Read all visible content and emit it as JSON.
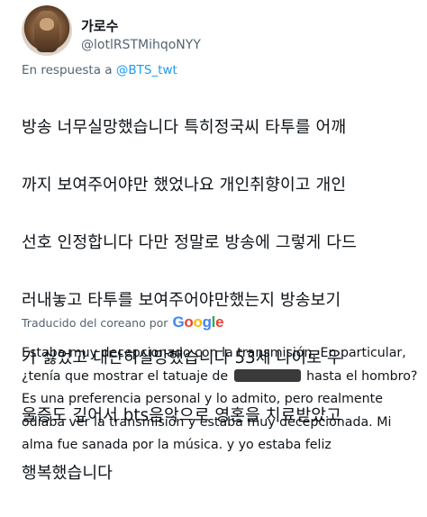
{
  "user": {
    "display_name": "가로수",
    "handle": "@lotlRSTMihqoNYY"
  },
  "reply": {
    "prefix": "En respuesta a",
    "mention": "@BTS_twt"
  },
  "tweet": {
    "lines": [
      "방송 너무실망했습니다 특히정국씨 타투를 어깨",
      "까지 보여주어야만 했었나요 개인취향이고 개인",
      "선호 인정합니다 다만 정말로 방송에 그렇게 다드",
      "러내놓고 타투를 보여주어야만했는지 방송보기",
      "가 싫었고 대단히실망했습니다 53세 나이로 우",
      "울증도 깊어서 bts음악으로 영혼을 치료받았고",
      "행복했습니다"
    ]
  },
  "translation": {
    "label": "Traducido del coreano por",
    "provider_letters": [
      "G",
      "o",
      "o",
      "g",
      "l",
      "e"
    ],
    "line1": "Estaba muy decepcionado con la transmisión. En particular,",
    "line2_before": "¿tenía que mostrar el tatuaje de",
    "line2_after": "hasta el hombro?",
    "line3": "Es una preferencia personal y lo admito, pero realmente",
    "line4": "odiaba ver la transmisión y estaba muy decepcionada. Mi",
    "line5": "alma fue sanada por la música. y yo estaba feliz"
  }
}
